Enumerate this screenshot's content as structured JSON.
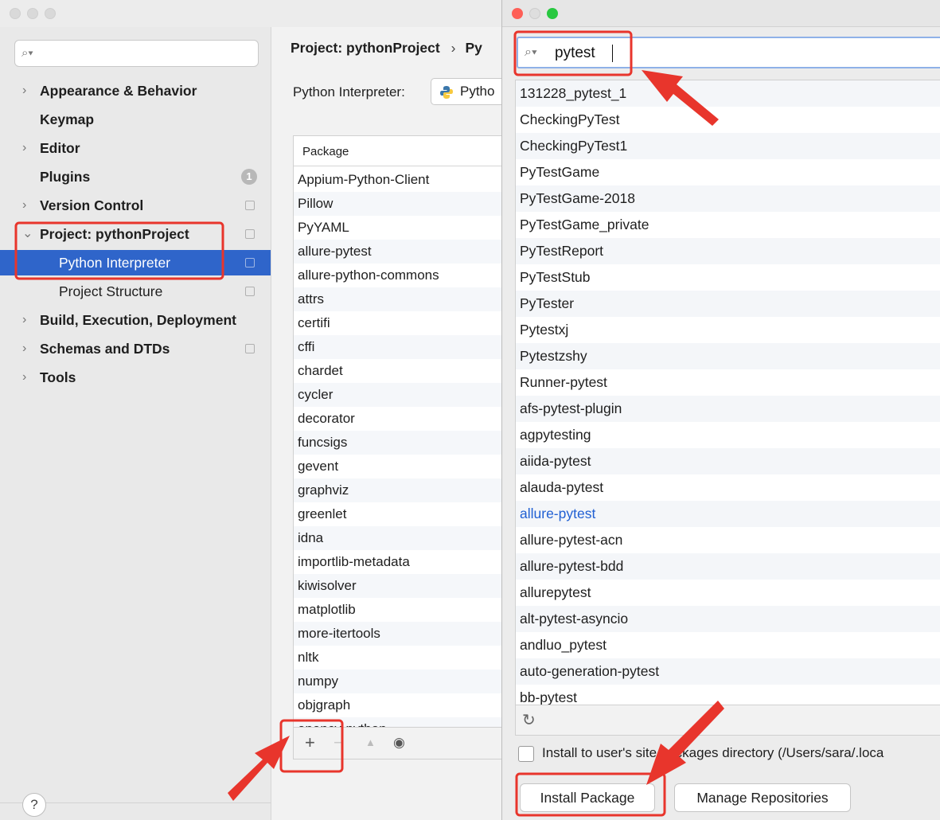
{
  "settings": {
    "sidebar": {
      "search_icon": "search-icon",
      "items": [
        {
          "label": "Appearance & Behavior",
          "chevron": "›"
        },
        {
          "label": "Keymap"
        },
        {
          "label": "Editor",
          "chevron": "›"
        },
        {
          "label": "Plugins",
          "badge": "1"
        },
        {
          "label": "Version Control",
          "chevron": "›"
        },
        {
          "label": "Project: pythonProject",
          "chevron": "⌄"
        },
        {
          "label": "Python Interpreter"
        },
        {
          "label": "Project Structure"
        },
        {
          "label": "Build, Execution, Deployment",
          "chevron": "›"
        },
        {
          "label": "Schemas and DTDs",
          "chevron": "›"
        },
        {
          "label": "Tools",
          "chevron": "›"
        }
      ],
      "help": "?"
    },
    "main": {
      "breadcrumb_root": "Project: pythonProject",
      "breadcrumb_sep": "›",
      "breadcrumb_child": "Py",
      "interpreter_label": "Python Interpreter:",
      "interpreter_value": "Pytho",
      "table_header": "Package",
      "packages": [
        "Appium-Python-Client",
        "Pillow",
        "PyYAML",
        "allure-pytest",
        "allure-python-commons",
        "attrs",
        "certifi",
        "cffi",
        "chardet",
        "cycler",
        "decorator",
        "funcsigs",
        "gevent",
        "graphviz",
        "greenlet",
        "idna",
        "importlib-metadata",
        "kiwisolver",
        "matplotlib",
        "more-itertools",
        "nltk",
        "numpy",
        "objgraph",
        "opencv-python"
      ],
      "toolbar": {
        "add": "+",
        "remove": "−",
        "up": "▲",
        "show": "◉"
      }
    }
  },
  "dialog": {
    "search_value": "pytest",
    "results": [
      "131228_pytest_1",
      "CheckingPyTest",
      "CheckingPyTest1",
      "PyTestGame",
      "PyTestGame-2018",
      "PyTestGame_private",
      "PyTestReport",
      "PyTestStub",
      "PyTester",
      "Pytestxj",
      "Pytestzshy",
      "Runner-pytest",
      "afs-pytest-plugin",
      "agpytesting",
      "aiida-pytest",
      "alauda-pytest",
      "allure-pytest",
      "allure-pytest-acn",
      "allure-pytest-bdd",
      "allurepytest",
      "alt-pytest-asyncio",
      "andluo_pytest",
      "auto-generation-pytest",
      "bb-pytest"
    ],
    "highlighted": "allure-pytest",
    "refresh": "↻",
    "user_site_label": "Install to user's site packages directory (/Users/sara/.loca",
    "install_button": "Install Package",
    "manage_button": "Manage Repositories"
  },
  "colors": {
    "selection": "#2f65ca",
    "link": "#2160d3",
    "annotation": "#e8352c"
  }
}
